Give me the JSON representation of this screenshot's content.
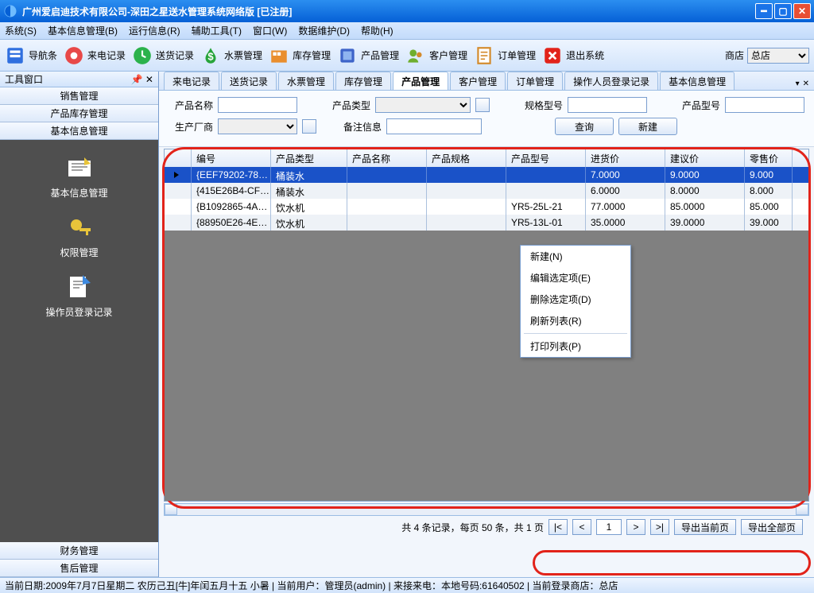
{
  "window": {
    "title": "广州爱启迪技术有限公司-深田之星送水管理系统网络版  [已注册]"
  },
  "menubar": [
    "系统(S)",
    "基本信息管理(B)",
    "运行信息(R)",
    "辅助工具(T)",
    "窗口(W)",
    "数据维护(D)",
    "帮助(H)"
  ],
  "toolbar": [
    {
      "label": "导航条",
      "iconColor": "#2f6fdf"
    },
    {
      "label": "来电记录",
      "iconColor": "#e84848"
    },
    {
      "label": "送货记录",
      "iconColor": "#2bb24c"
    },
    {
      "label": "水票管理",
      "iconColor": "#27a43a"
    },
    {
      "label": "库存管理",
      "iconColor": "#e98e2e"
    },
    {
      "label": "产品管理",
      "iconColor": "#3e64c9"
    },
    {
      "label": "客户管理",
      "iconColor": "#6fae2e"
    },
    {
      "label": "订单管理",
      "iconColor": "#d38a2b"
    },
    {
      "label": "退出系统",
      "iconColor": "#e2231a"
    }
  ],
  "storeLabel": "商店",
  "storeValue": "总店",
  "leftHeader": "工具窗口",
  "leftSections": [
    "销售管理",
    "产品库存管理",
    "基本信息管理"
  ],
  "leftItems": [
    "基本信息管理",
    "权限管理",
    "操作员登录记录"
  ],
  "leftBottom": [
    "财务管理",
    "售后管理"
  ],
  "tabs": [
    "来电记录",
    "送货记录",
    "水票管理",
    "库存管理",
    "产品管理",
    "客户管理",
    "订单管理",
    "操作人员登录记录",
    "基本信息管理"
  ],
  "activeTab": "产品管理",
  "filter": {
    "nameLabel": "产品名称",
    "typeLabel": "产品类型",
    "specLabel": "规格型号",
    "modelLabel": "产品型号",
    "vendorLabel": "生产厂商",
    "remarkLabel": "备注信息",
    "queryBtn": "查询",
    "newBtn": "新建"
  },
  "columns": [
    "编号",
    "产品类型",
    "产品名称",
    "产品规格",
    "产品型号",
    "进货价",
    "建议价",
    "零售价"
  ],
  "rows": [
    {
      "id": "{EEF79202-78…",
      "type": "桶装水",
      "name": "",
      "spec": "",
      "model": "",
      "inprice": "7.0000",
      "sugprice": "9.0000",
      "sale": "9.000"
    },
    {
      "id": "{415E26B4-CF…",
      "type": "桶装水",
      "name": "",
      "spec": "",
      "model": "",
      "inprice": "6.0000",
      "sugprice": "8.0000",
      "sale": "8.000"
    },
    {
      "id": "{B1092865-4A…",
      "type": "饮水机",
      "name": "",
      "spec": "",
      "model": "YR5-25L-21",
      "inprice": "77.0000",
      "sugprice": "85.0000",
      "sale": "85.000"
    },
    {
      "id": "{88950E26-4E…",
      "type": "饮水机",
      "name": "",
      "spec": "",
      "model": "YR5-13L-01",
      "inprice": "35.0000",
      "sugprice": "39.0000",
      "sale": "39.000"
    }
  ],
  "contextMenu": [
    "新建(N)",
    "编辑选定项(E)",
    "删除选定项(D)",
    "刷新列表(R)",
    "打印列表(P)"
  ],
  "footer": {
    "summary": "共 4 条记录，每页 50 条，共 1 页",
    "pageValue": "1",
    "first": "|<",
    "prev": "<",
    "next": ">",
    "last": ">|",
    "exportPage": "导出当前页",
    "exportAll": "导出全部页"
  },
  "statusbar": "当前日期:2009年7月7日星期二 农历己丑[牛]年闰五月十五 小暑 | 当前用户：管理员(admin) | 来接来电：本地号码:61640502 | 当前登录商店：总店"
}
